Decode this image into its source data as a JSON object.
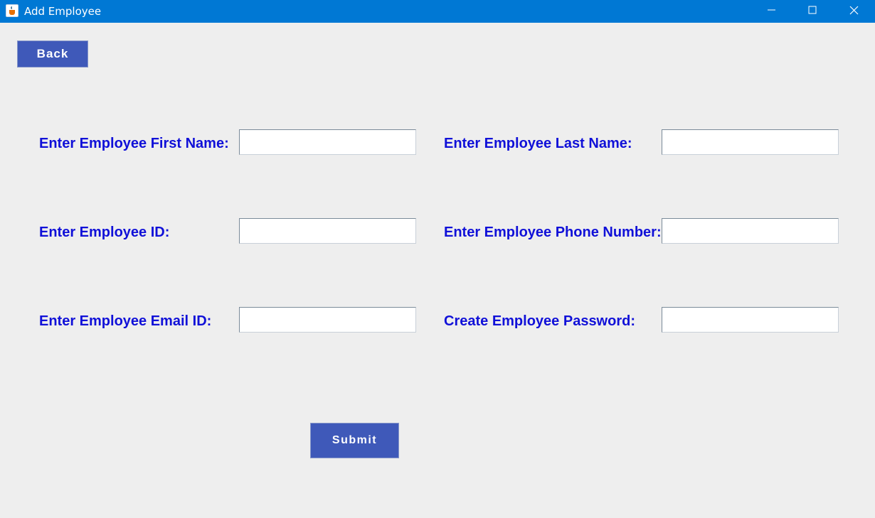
{
  "window": {
    "title": "Add Employee",
    "app_icon": "java-icon",
    "controls": [
      "minimize-icon",
      "maximize-icon",
      "close-icon"
    ]
  },
  "toolbar": {
    "back_label": "Back"
  },
  "form": {
    "fields": [
      {
        "label": "Enter Employee First Name:",
        "value": "",
        "placeholder": ""
      },
      {
        "label": "Enter Employee Last Name:",
        "value": "",
        "placeholder": ""
      },
      {
        "label": "Enter Employee ID:",
        "value": "",
        "placeholder": ""
      },
      {
        "label": "Enter Employee Phone Number:",
        "value": "",
        "placeholder": ""
      },
      {
        "label": "Enter Employee Email ID:",
        "value": "",
        "placeholder": ""
      },
      {
        "label": "Create Employee Password:",
        "value": "",
        "placeholder": ""
      }
    ],
    "submit_label": "Submit"
  },
  "colors": {
    "titlebar": "#0078d4",
    "background": "#eeeeee",
    "button": "#3f59b9",
    "label_text": "#1010d8"
  }
}
